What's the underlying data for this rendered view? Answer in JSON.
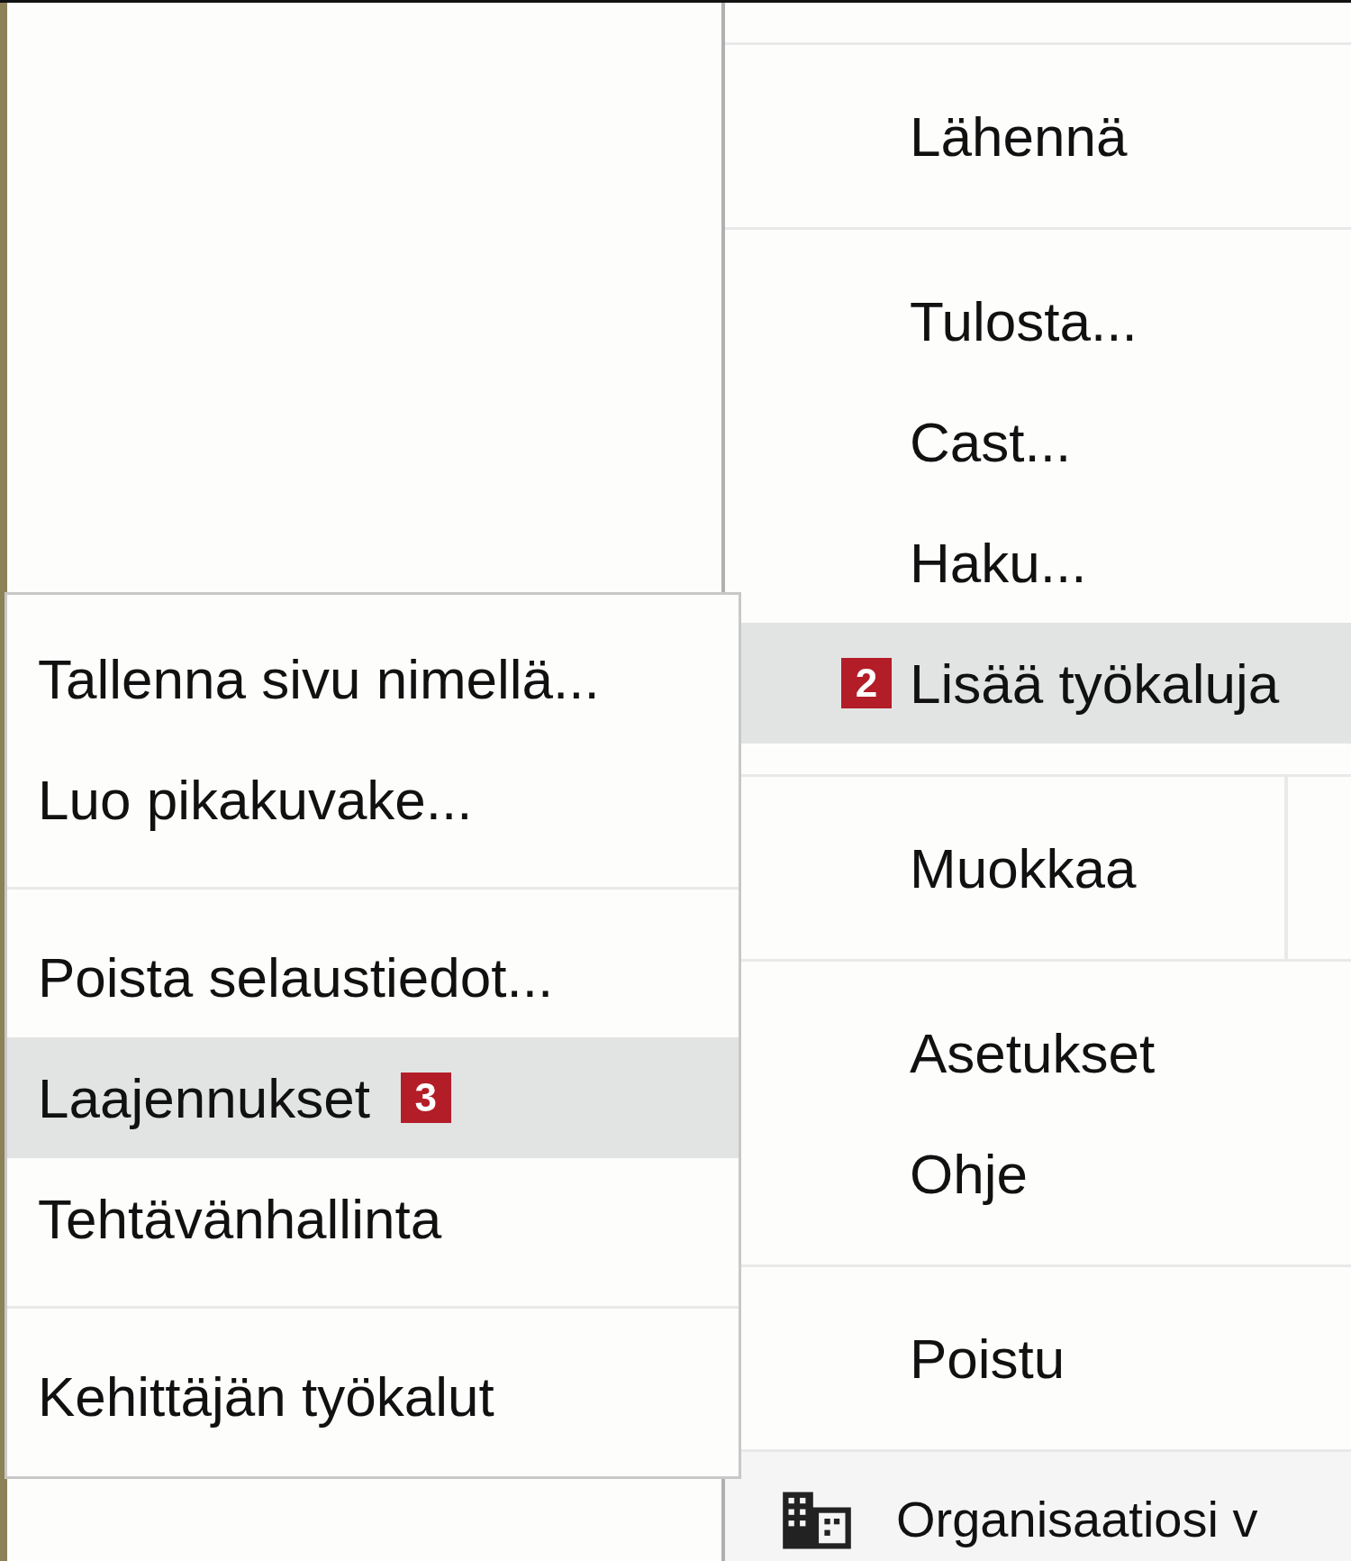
{
  "main_menu": {
    "groups": [
      {
        "items": [
          {
            "kind": "item",
            "label": "Lähennä",
            "highlighted": false
          }
        ]
      },
      {
        "items": [
          {
            "kind": "item",
            "label": "Tulosta...",
            "highlighted": false
          },
          {
            "kind": "item",
            "label": "Cast...",
            "highlighted": false
          },
          {
            "kind": "item",
            "label": "Haku...",
            "highlighted": false
          },
          {
            "kind": "item",
            "label": "Lisää työkaluja",
            "highlighted": true,
            "badge": "2"
          }
        ]
      },
      {
        "items": [
          {
            "kind": "edit",
            "label": "Muokkaa",
            "highlighted": false
          }
        ]
      },
      {
        "items": [
          {
            "kind": "item",
            "label": "Asetukset",
            "highlighted": false
          },
          {
            "kind": "item",
            "label": "Ohje",
            "highlighted": false
          }
        ]
      },
      {
        "items": [
          {
            "kind": "item",
            "label": "Poistu",
            "highlighted": false
          }
        ]
      },
      {
        "items": [
          {
            "kind": "managed",
            "label": "Organisaatiosi v",
            "highlighted": false
          }
        ]
      }
    ]
  },
  "submenu": {
    "groups": [
      {
        "items": [
          {
            "label": "Tallenna sivu nimellä...",
            "highlighted": false
          },
          {
            "label": "Luo pikakuvake...",
            "highlighted": false
          }
        ]
      },
      {
        "items": [
          {
            "label": "Poista selaustiedot...",
            "highlighted": false
          },
          {
            "label": "Laajennukset",
            "highlighted": true,
            "badge": "3"
          },
          {
            "label": "Tehtävänhallinta",
            "highlighted": false
          }
        ]
      },
      {
        "items": [
          {
            "label": "Kehittäjän työkalut",
            "highlighted": false
          }
        ]
      }
    ]
  }
}
